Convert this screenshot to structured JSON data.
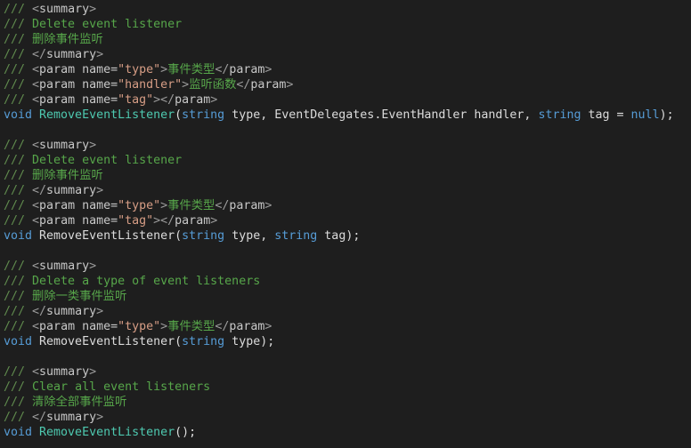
{
  "editor": {
    "background": "#1e1e1e",
    "token_colors": {
      "doc_prefix": "#608b4e",
      "doc_text": "#57a64a",
      "xml_tag": "#9b9b9b",
      "xml_attr_value": "#d69d85",
      "keyword": "#569cd6",
      "method_highlight": "#4ec9b0",
      "plain": "#dcdcdc"
    },
    "lines": [
      [
        {
          "t": "doc",
          "v": "/// "
        },
        {
          "t": "tag",
          "v": "<"
        },
        {
          "t": "attr",
          "v": "summary"
        },
        {
          "t": "tag",
          "v": ">"
        }
      ],
      [
        {
          "t": "doc",
          "v": "/// "
        },
        {
          "t": "comment",
          "v": "Delete event listener"
        }
      ],
      [
        {
          "t": "doc",
          "v": "/// "
        },
        {
          "t": "comment",
          "v": "删除事件监听"
        }
      ],
      [
        {
          "t": "doc",
          "v": "/// "
        },
        {
          "t": "tag",
          "v": "</"
        },
        {
          "t": "attr",
          "v": "summary"
        },
        {
          "t": "tag",
          "v": ">"
        }
      ],
      [
        {
          "t": "doc",
          "v": "/// "
        },
        {
          "t": "tag",
          "v": "<"
        },
        {
          "t": "attr",
          "v": "param name="
        },
        {
          "t": "attrval",
          "v": "\"type\""
        },
        {
          "t": "tag",
          "v": ">"
        },
        {
          "t": "comment",
          "v": "事件类型"
        },
        {
          "t": "tag",
          "v": "</"
        },
        {
          "t": "attr",
          "v": "param"
        },
        {
          "t": "tag",
          "v": ">"
        }
      ],
      [
        {
          "t": "doc",
          "v": "/// "
        },
        {
          "t": "tag",
          "v": "<"
        },
        {
          "t": "attr",
          "v": "param name="
        },
        {
          "t": "attrval",
          "v": "\"handler\""
        },
        {
          "t": "tag",
          "v": ">"
        },
        {
          "t": "comment",
          "v": "监听函数"
        },
        {
          "t": "tag",
          "v": "</"
        },
        {
          "t": "attr",
          "v": "param"
        },
        {
          "t": "tag",
          "v": ">"
        }
      ],
      [
        {
          "t": "doc",
          "v": "/// "
        },
        {
          "t": "tag",
          "v": "<"
        },
        {
          "t": "attr",
          "v": "param name="
        },
        {
          "t": "attrval",
          "v": "\"tag\""
        },
        {
          "t": "tag",
          "v": "></"
        },
        {
          "t": "attr",
          "v": "param"
        },
        {
          "t": "tag",
          "v": ">"
        }
      ],
      [
        {
          "t": "keyword",
          "v": "void "
        },
        {
          "t": "method",
          "v": "RemoveEventListener"
        },
        {
          "t": "punc",
          "v": "("
        },
        {
          "t": "keyword",
          "v": "string"
        },
        {
          "t": "plain",
          "v": " type, EventDelegates.EventHandler handler, "
        },
        {
          "t": "keyword",
          "v": "string"
        },
        {
          "t": "plain",
          "v": " tag = "
        },
        {
          "t": "keyword",
          "v": "null"
        },
        {
          "t": "punc",
          "v": ");"
        }
      ],
      [],
      [
        {
          "t": "doc",
          "v": "/// "
        },
        {
          "t": "tag",
          "v": "<"
        },
        {
          "t": "attr",
          "v": "summary"
        },
        {
          "t": "tag",
          "v": ">"
        }
      ],
      [
        {
          "t": "doc",
          "v": "/// "
        },
        {
          "t": "comment",
          "v": "Delete event listener"
        }
      ],
      [
        {
          "t": "doc",
          "v": "/// "
        },
        {
          "t": "comment",
          "v": "删除事件监听"
        }
      ],
      [
        {
          "t": "doc",
          "v": "/// "
        },
        {
          "t": "tag",
          "v": "</"
        },
        {
          "t": "attr",
          "v": "summary"
        },
        {
          "t": "tag",
          "v": ">"
        }
      ],
      [
        {
          "t": "doc",
          "v": "/// "
        },
        {
          "t": "tag",
          "v": "<"
        },
        {
          "t": "attr",
          "v": "param name="
        },
        {
          "t": "attrval",
          "v": "\"type\""
        },
        {
          "t": "tag",
          "v": ">"
        },
        {
          "t": "comment",
          "v": "事件类型"
        },
        {
          "t": "tag",
          "v": "</"
        },
        {
          "t": "attr",
          "v": "param"
        },
        {
          "t": "tag",
          "v": ">"
        }
      ],
      [
        {
          "t": "doc",
          "v": "/// "
        },
        {
          "t": "tag",
          "v": "<"
        },
        {
          "t": "attr",
          "v": "param name="
        },
        {
          "t": "attrval",
          "v": "\"tag\""
        },
        {
          "t": "tag",
          "v": "></"
        },
        {
          "t": "attr",
          "v": "param"
        },
        {
          "t": "tag",
          "v": ">"
        }
      ],
      [
        {
          "t": "keyword",
          "v": "void "
        },
        {
          "t": "plain",
          "v": "RemoveEventListener"
        },
        {
          "t": "punc",
          "v": "("
        },
        {
          "t": "keyword",
          "v": "string"
        },
        {
          "t": "plain",
          "v": " type, "
        },
        {
          "t": "keyword",
          "v": "string"
        },
        {
          "t": "plain",
          "v": " tag"
        },
        {
          "t": "punc",
          "v": ");"
        }
      ],
      [],
      [
        {
          "t": "doc",
          "v": "/// "
        },
        {
          "t": "tag",
          "v": "<"
        },
        {
          "t": "attr",
          "v": "summary"
        },
        {
          "t": "tag",
          "v": ">"
        }
      ],
      [
        {
          "t": "doc",
          "v": "/// "
        },
        {
          "t": "comment",
          "v": "Delete a type of event listeners"
        }
      ],
      [
        {
          "t": "doc",
          "v": "/// "
        },
        {
          "t": "comment",
          "v": "删除一类事件监听"
        }
      ],
      [
        {
          "t": "doc",
          "v": "/// "
        },
        {
          "t": "tag",
          "v": "</"
        },
        {
          "t": "attr",
          "v": "summary"
        },
        {
          "t": "tag",
          "v": ">"
        }
      ],
      [
        {
          "t": "doc",
          "v": "/// "
        },
        {
          "t": "tag",
          "v": "<"
        },
        {
          "t": "attr",
          "v": "param name="
        },
        {
          "t": "attrval",
          "v": "\"type\""
        },
        {
          "t": "tag",
          "v": ">"
        },
        {
          "t": "comment",
          "v": "事件类型"
        },
        {
          "t": "tag",
          "v": "</"
        },
        {
          "t": "attr",
          "v": "param"
        },
        {
          "t": "tag",
          "v": ">"
        }
      ],
      [
        {
          "t": "keyword",
          "v": "void "
        },
        {
          "t": "plain",
          "v": "RemoveEventListener"
        },
        {
          "t": "punc",
          "v": "("
        },
        {
          "t": "keyword",
          "v": "string"
        },
        {
          "t": "plain",
          "v": " type"
        },
        {
          "t": "punc",
          "v": ");"
        }
      ],
      [],
      [
        {
          "t": "doc",
          "v": "/// "
        },
        {
          "t": "tag",
          "v": "<"
        },
        {
          "t": "attr",
          "v": "summary"
        },
        {
          "t": "tag",
          "v": ">"
        }
      ],
      [
        {
          "t": "doc",
          "v": "/// "
        },
        {
          "t": "comment",
          "v": "Clear all event listeners"
        }
      ],
      [
        {
          "t": "doc",
          "v": "/// "
        },
        {
          "t": "comment",
          "v": "清除全部事件监听"
        }
      ],
      [
        {
          "t": "doc",
          "v": "/// "
        },
        {
          "t": "tag",
          "v": "</"
        },
        {
          "t": "attr",
          "v": "summary"
        },
        {
          "t": "tag",
          "v": ">"
        }
      ],
      [
        {
          "t": "keyword",
          "v": "void "
        },
        {
          "t": "method",
          "v": "RemoveEventListener"
        },
        {
          "t": "punc",
          "v": "();"
        }
      ]
    ]
  }
}
